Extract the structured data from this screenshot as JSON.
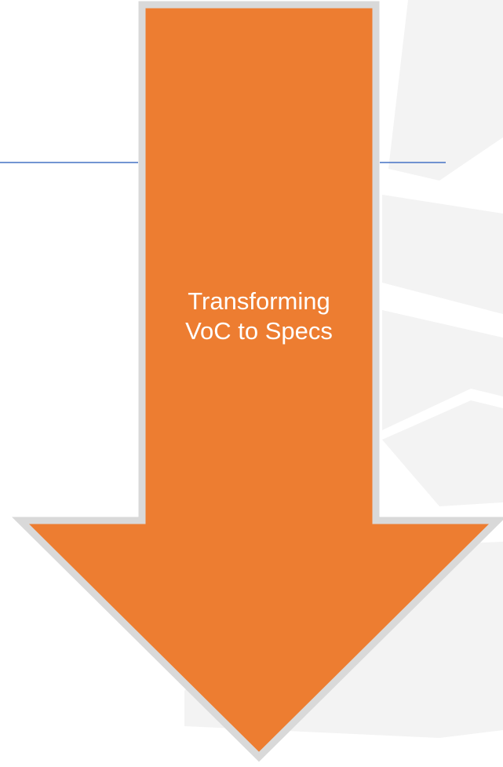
{
  "diagram": {
    "arrow_label_lines": [
      "Transforming",
      "VoC to Specs"
    ],
    "colors": {
      "arrow_fill": "#ED7D31",
      "arrow_outline": "#D9D9D9",
      "rule_line": "#4472C4",
      "watermark": "#F2F2F2",
      "text": "#FFFFFF"
    }
  }
}
